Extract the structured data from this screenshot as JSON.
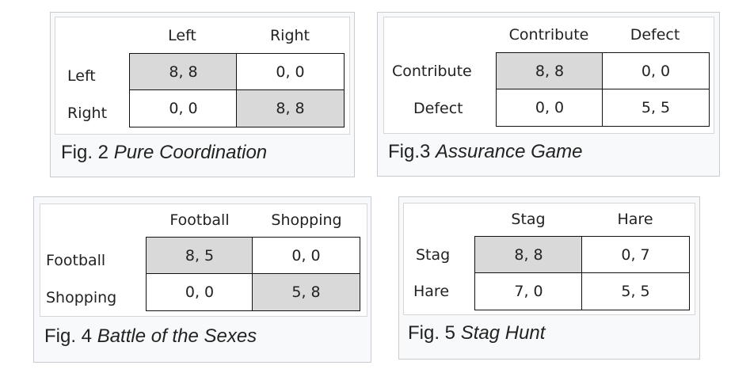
{
  "figures": [
    {
      "col_labels": [
        "Left",
        "Right"
      ],
      "row_labels": [
        "Left",
        "Right"
      ],
      "cells": [
        [
          "8, 8",
          "0, 0"
        ],
        [
          "0, 0",
          "8, 8"
        ]
      ],
      "shaded": [
        [
          true,
          false
        ],
        [
          false,
          true
        ]
      ],
      "caption_prefix": "Fig. 2",
      "caption_title": "Pure Coordination"
    },
    {
      "col_labels": [
        "Contribute",
        "Defect"
      ],
      "row_labels": [
        "Contribute",
        "Defect"
      ],
      "cells": [
        [
          "8, 8",
          "0, 0"
        ],
        [
          "0, 0",
          "5, 5"
        ]
      ],
      "shaded": [
        [
          true,
          false
        ],
        [
          false,
          false
        ]
      ],
      "caption_prefix": "Fig.3",
      "caption_title": "Assurance Game"
    },
    {
      "col_labels": [
        "Football",
        "Shopping"
      ],
      "row_labels": [
        "Football",
        "Shopping"
      ],
      "cells": [
        [
          "8, 5",
          "0, 0"
        ],
        [
          "0, 0",
          "5, 8"
        ]
      ],
      "shaded": [
        [
          true,
          false
        ],
        [
          false,
          true
        ]
      ],
      "caption_prefix": "Fig. 4",
      "caption_title": "Battle of the Sexes"
    },
    {
      "col_labels": [
        "Stag",
        "Hare"
      ],
      "row_labels": [
        "Stag",
        "Hare"
      ],
      "cells": [
        [
          "8, 8",
          "0, 7"
        ],
        [
          "7, 0",
          "5, 5"
        ]
      ],
      "shaded": [
        [
          true,
          false
        ],
        [
          false,
          false
        ]
      ],
      "caption_prefix": "Fig. 5",
      "caption_title": "Stag Hunt"
    }
  ]
}
